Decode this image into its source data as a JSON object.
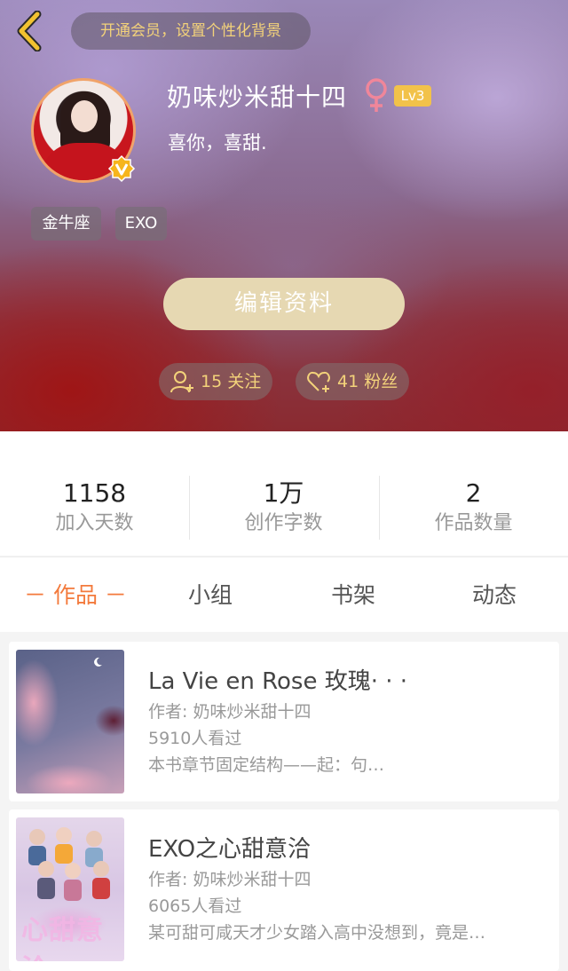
{
  "header": {
    "vip_banner": "开通会员，设置个性化背景",
    "username": "奶味炒米甜十四",
    "gender_symbol": "♀",
    "level": "Lv3",
    "bio": "喜你，喜甜.",
    "tags": [
      "金牛座",
      "EXO"
    ],
    "edit_button": "编辑资料",
    "following": "15 关注",
    "fans": "41 粉丝",
    "colors": {
      "accent_gold": "#f3d27a",
      "level_badge": "#f2c24a",
      "edit_button_bg": "#e6d8b2",
      "gender_pink": "#f0869a"
    }
  },
  "stats": [
    {
      "value": "1158",
      "label": "加入天数"
    },
    {
      "value": "1万",
      "label": "创作字数"
    },
    {
      "value": "2",
      "label": "作品数量"
    }
  ],
  "tabs": [
    {
      "label": "－ 作品 －",
      "active": true
    },
    {
      "label": "小组",
      "active": false
    },
    {
      "label": "书架",
      "active": false
    },
    {
      "label": "动态",
      "active": false
    }
  ],
  "works": [
    {
      "title": "La Vie en Rose 玫瑰· · ·",
      "author": "作者: 奶味炒米甜十四",
      "views": "5910人看过",
      "desc": "本书章节固定结构——起：句…"
    },
    {
      "title": "EXO之心甜意洽",
      "author": "作者: 奶味炒米甜十四",
      "views": "6065人看过",
      "desc": "某可甜可咸天才少女踏入高中没想到，竟是…",
      "cover_text": "心甜意洽"
    }
  ],
  "icons": {
    "back": "chevron-left-icon",
    "verified": "verified-v-badge-icon",
    "following": "user-plus-icon",
    "fans": "heart-plus-icon"
  },
  "tab_active_color": "#f37a3c"
}
